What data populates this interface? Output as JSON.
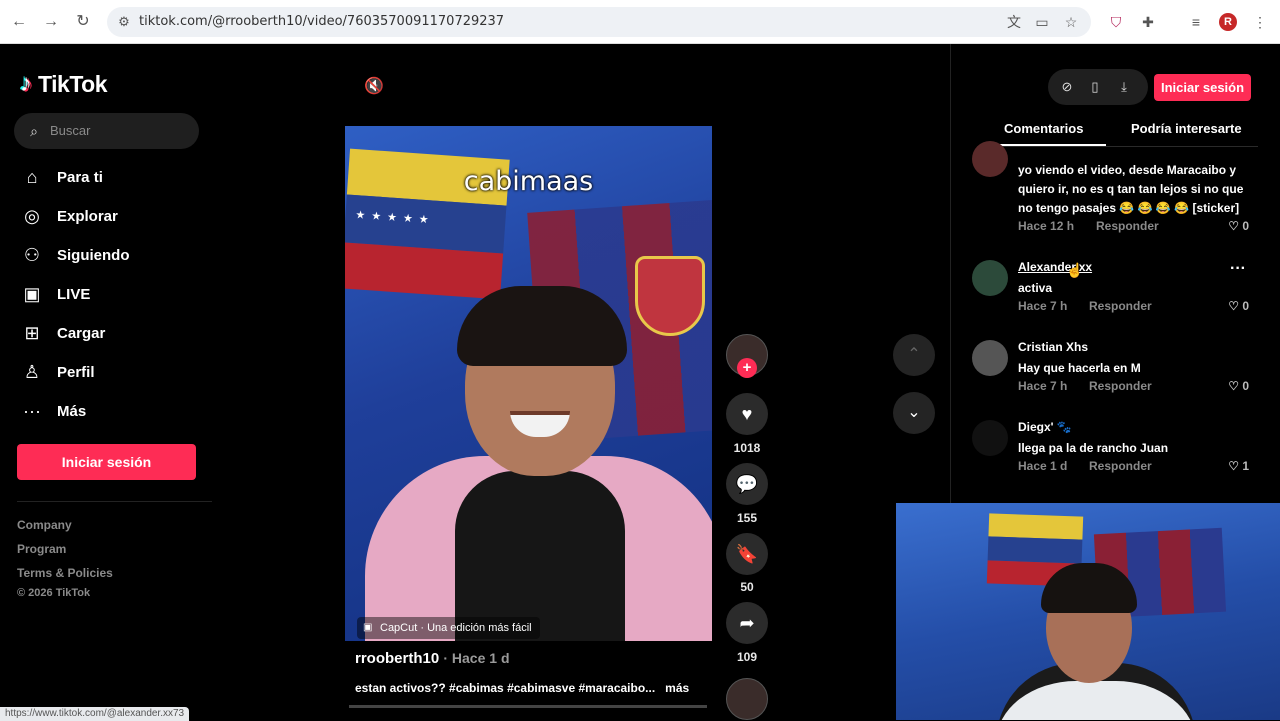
{
  "browser": {
    "url": "tiktok.com/@rrooberth10/video/7603570091170729237",
    "profile_initial": "R",
    "status_url": "https://www.tiktok.com/@alexander.xx73"
  },
  "sidebar": {
    "logo": "TikTok",
    "search_placeholder": "Buscar",
    "items": [
      {
        "label": "Para ti",
        "icon": "home-icon"
      },
      {
        "label": "Explorar",
        "icon": "compass-icon"
      },
      {
        "label": "Siguiendo",
        "icon": "following-icon"
      },
      {
        "label": "LIVE",
        "icon": "live-icon"
      },
      {
        "label": "Cargar",
        "icon": "upload-icon"
      },
      {
        "label": "Perfil",
        "icon": "profile-icon"
      },
      {
        "label": "Más",
        "icon": "more-icon"
      }
    ],
    "login": "Iniciar sesión",
    "footer": [
      "Company",
      "Program",
      "Terms & Policies",
      "© 2026 TikTok"
    ]
  },
  "video": {
    "caption": "cabimaas",
    "capcut": "CapCut · Una edición más fácil",
    "author": "rrooberth10",
    "time": "· Hace 1 d",
    "description": "estan activos?? #cabimas #cabimasve #maracaibo...",
    "more": "más",
    "likes": "1018",
    "comments": "155",
    "saves": "50",
    "shares": "109"
  },
  "panel": {
    "login": "Iniciar sesión",
    "tabs": [
      "Comentarios",
      "Podría interesarte"
    ],
    "comments": [
      {
        "name": "",
        "text": "yo viendo el video, desde Maracaibo y quiero ir, no es q tan tan lejos si no que no tengo pasajes 😂 😂 😂 😂 [sticker]",
        "time": "Hace 12 h",
        "reply": "Responder",
        "likes": "0"
      },
      {
        "name": "Alexander.xx",
        "text": "activa",
        "time": "Hace 7 h",
        "reply": "Responder",
        "likes": "0"
      },
      {
        "name": "Cristian Xhs",
        "text": "Hay que hacerla en M",
        "time": "Hace 7 h",
        "reply": "Responder",
        "likes": "0"
      },
      {
        "name": "Diegx' 🐾",
        "text": "llega pa la de rancho Juan",
        "time": "Hace 1 d",
        "reply": "Responder",
        "likes": "1"
      }
    ]
  }
}
